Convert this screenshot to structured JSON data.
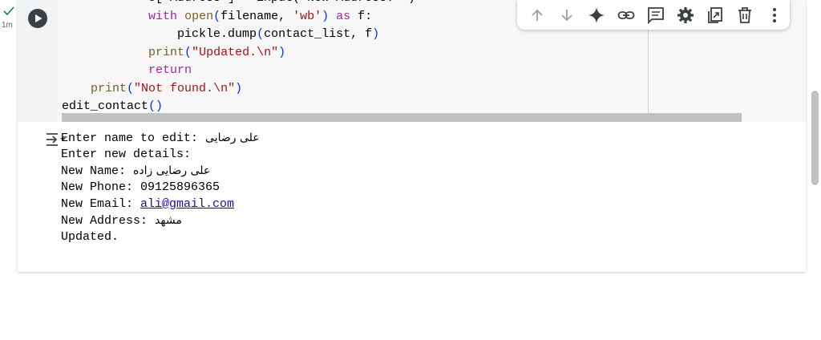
{
  "gutter": {
    "status": "✓",
    "time": "1m"
  },
  "code": {
    "lines": [
      {
        "indent": "            ",
        "parts": [
          {
            "t": "c[\"Address\"] = input(\"New Address: \")",
            "c": ""
          }
        ]
      },
      {
        "indent": "            ",
        "parts": [
          {
            "t": "with",
            "c": "kw"
          },
          {
            "t": " ",
            "c": ""
          },
          {
            "t": "open",
            "c": "fn"
          },
          {
            "t": "(",
            "c": "paren"
          },
          {
            "t": "filename, ",
            "c": ""
          },
          {
            "t": "'wb'",
            "c": "str"
          },
          {
            "t": ")",
            "c": "paren"
          },
          {
            "t": " ",
            "c": ""
          },
          {
            "t": "as",
            "c": "kw"
          },
          {
            "t": " f:",
            "c": ""
          }
        ]
      },
      {
        "indent": "                ",
        "parts": [
          {
            "t": "pickle.dump",
            "c": ""
          },
          {
            "t": "(",
            "c": "paren"
          },
          {
            "t": "contact_list, f",
            "c": ""
          },
          {
            "t": ")",
            "c": "paren"
          }
        ]
      },
      {
        "indent": "            ",
        "parts": [
          {
            "t": "print",
            "c": "fn"
          },
          {
            "t": "(",
            "c": "paren"
          },
          {
            "t": "\"Updated.\\n\"",
            "c": "str"
          },
          {
            "t": ")",
            "c": "paren"
          }
        ]
      },
      {
        "indent": "            ",
        "parts": [
          {
            "t": "return",
            "c": "kw"
          }
        ]
      },
      {
        "indent": "    ",
        "parts": [
          {
            "t": "print",
            "c": "fn"
          },
          {
            "t": "(",
            "c": "paren"
          },
          {
            "t": "\"Not found.\\n\"",
            "c": "str"
          },
          {
            "t": ")",
            "c": "paren"
          }
        ]
      },
      {
        "indent": "",
        "parts": [
          {
            "t": "edit_contact",
            "c": ""
          },
          {
            "t": "()",
            "c": "paren"
          }
        ]
      }
    ]
  },
  "toolbar": {
    "buttons": [
      {
        "name": "move-cell-up",
        "icon": "arrow-up-icon"
      },
      {
        "name": "move-cell-down",
        "icon": "arrow-down-icon"
      },
      {
        "name": "gemini",
        "icon": "sparkle-icon"
      },
      {
        "name": "copy-link",
        "icon": "link-icon"
      },
      {
        "name": "add-comment",
        "icon": "comment-icon"
      },
      {
        "name": "cell-settings",
        "icon": "gear-icon"
      },
      {
        "name": "mirror-cell",
        "icon": "mirror-icon"
      },
      {
        "name": "delete-cell",
        "icon": "trash-icon"
      },
      {
        "name": "more-actions",
        "icon": "more-vert-icon"
      }
    ]
  },
  "output": {
    "lines": [
      {
        "label": "Enter name to edit: ",
        "value": "علی رضایی",
        "type": "rtl"
      },
      {
        "label": "Enter new details:",
        "value": "",
        "type": "plain"
      },
      {
        "label": "New Name: ",
        "value": "علی رضایی زاده",
        "type": "rtl"
      },
      {
        "label": "New Phone: ",
        "value": "09125896365",
        "type": "plain"
      },
      {
        "label": "New Email: ",
        "value": "ali@gmail.com",
        "type": "link"
      },
      {
        "label": "New Address: ",
        "value": "مشهد",
        "type": "rtl"
      },
      {
        "label": "Updated.",
        "value": "",
        "type": "plain"
      }
    ]
  },
  "colors": {
    "code_bg": "#f7f7f7",
    "link": "#1a0dab",
    "keyword": "#a626a4",
    "string": "#a31515"
  }
}
